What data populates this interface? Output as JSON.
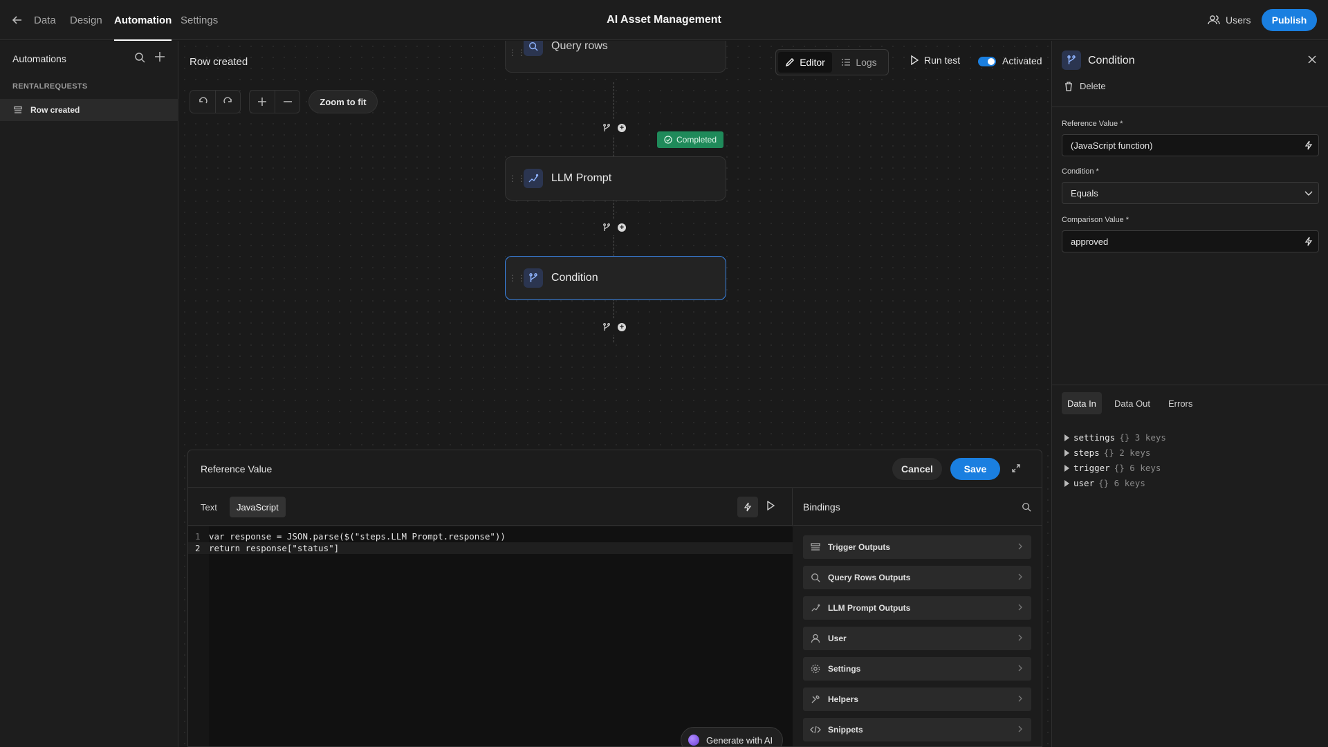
{
  "topbar": {
    "nav": [
      "Data",
      "Design",
      "Automation",
      "Settings"
    ],
    "active_nav": "Automation",
    "app_title": "AI Asset Management",
    "users_label": "Users",
    "publish_label": "Publish",
    "accent_color": "#1a7fe0"
  },
  "sidebar": {
    "title": "Automations",
    "section": "RENTALREQUESTS",
    "items": [
      {
        "label": "Row created",
        "selected": true
      }
    ]
  },
  "canvas": {
    "automation_name": "Row created",
    "view_tabs": [
      {
        "label": "Editor",
        "active": true
      },
      {
        "label": "Logs",
        "active": false
      }
    ],
    "run_test_label": "Run test",
    "activated_label": "Activated",
    "activated": true,
    "zoom_to_fit_label": "Zoom to fit",
    "nodes": [
      {
        "label": "Query rows",
        "icon": "search-icon",
        "partial": true
      },
      {
        "label": "LLM Prompt",
        "icon": "llm-icon",
        "status": "Completed"
      },
      {
        "label": "Condition",
        "icon": "branch-icon",
        "selected": true
      }
    ]
  },
  "editor": {
    "title": "Reference Value",
    "cancel_label": "Cancel",
    "save_label": "Save",
    "tabs": [
      {
        "label": "Text",
        "active": false
      },
      {
        "label": "JavaScript",
        "active": true
      }
    ],
    "code_lines": [
      "var response = JSON.parse($(\"steps.LLM Prompt.response\"))",
      "return response[\"status\"]"
    ],
    "generate_ai_label": "Generate with AI",
    "bindings": {
      "title": "Bindings",
      "items": [
        {
          "label": "Trigger Outputs",
          "icon": "trigger-icon"
        },
        {
          "label": "Query Rows Outputs",
          "icon": "search-icon"
        },
        {
          "label": "LLM Prompt Outputs",
          "icon": "llm-icon"
        },
        {
          "label": "User",
          "icon": "user-icon"
        },
        {
          "label": "Settings",
          "icon": "gear-icon"
        },
        {
          "label": "Helpers",
          "icon": "helpers-icon"
        },
        {
          "label": "Snippets",
          "icon": "code-icon"
        }
      ]
    }
  },
  "panel": {
    "title": "Condition",
    "delete_label": "Delete",
    "fields": [
      {
        "label": "Reference Value *",
        "value": "(JavaScript function)",
        "type": "binding"
      },
      {
        "label": "Condition *",
        "value": "Equals",
        "type": "select"
      },
      {
        "label": "Comparison Value *",
        "value": "approved",
        "type": "binding"
      }
    ],
    "tabs": [
      {
        "label": "Data In",
        "active": true
      },
      {
        "label": "Data Out",
        "active": false
      },
      {
        "label": "Errors",
        "active": false
      }
    ],
    "data_in": [
      {
        "key": "settings",
        "meta": "{} 3 keys"
      },
      {
        "key": "steps",
        "meta": "{} 2 keys"
      },
      {
        "key": "trigger",
        "meta": "{} 6 keys"
      },
      {
        "key": "user",
        "meta": "{} 6 keys"
      }
    ]
  }
}
